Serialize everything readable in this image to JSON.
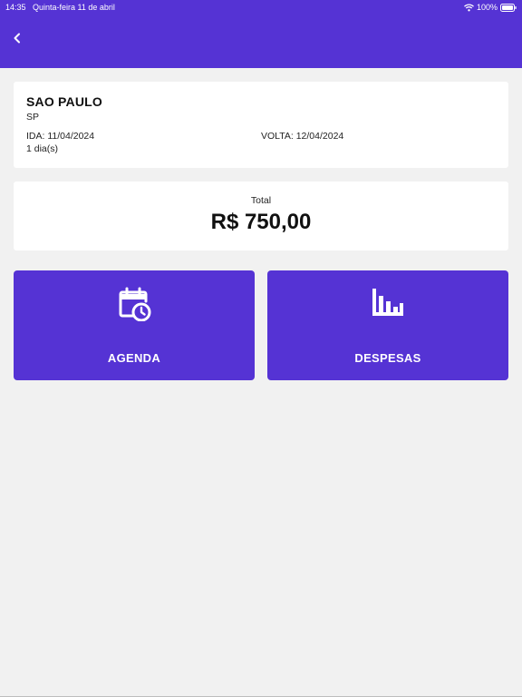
{
  "status_bar": {
    "time": "14:35",
    "date": "Quinta-feira 11 de abril",
    "battery": "100%"
  },
  "header": {
    "back_icon": "chevron-left-icon",
    "color": "#5533d4"
  },
  "trip": {
    "city": "SAO PAULO",
    "state": "SP",
    "depart": "IDA: 11/04/2024",
    "return": "VOLTA: 12/04/2024",
    "duration": "1 dia(s)"
  },
  "total": {
    "label": "Total",
    "value": "R$ 750,00"
  },
  "tiles": [
    {
      "label": "AGENDA",
      "icon": "calendar-clock-icon"
    },
    {
      "label": "DESPESAS",
      "icon": "bar-chart-icon"
    }
  ],
  "colors": {
    "accent": "#5533d4",
    "background": "#f1f1f1",
    "card": "#ffffff"
  }
}
